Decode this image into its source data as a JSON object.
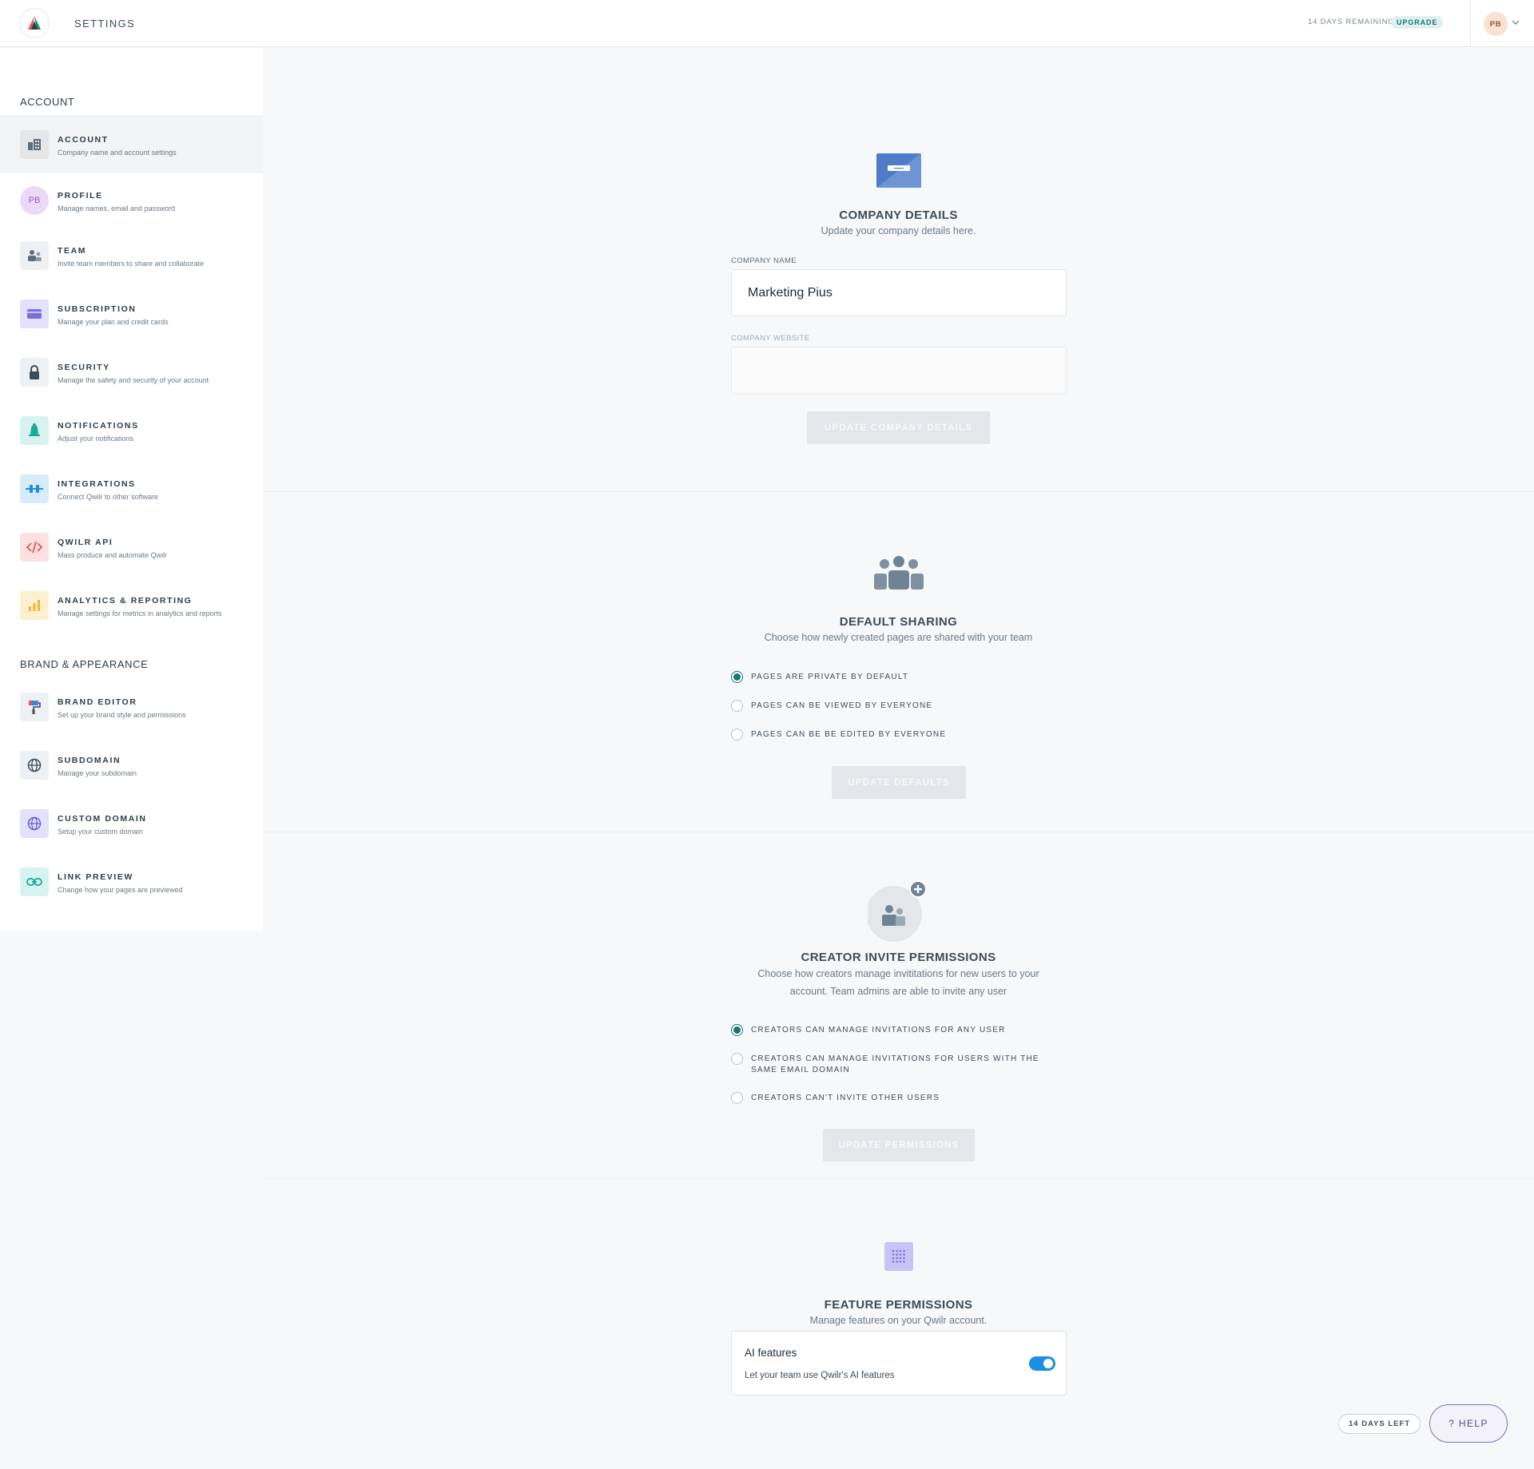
{
  "header": {
    "title": "SETTINGS",
    "trial_text": "14 DAYS REMAINING",
    "upgrade_label": "UPGRADE",
    "avatar_initials": "PB"
  },
  "sidebar": {
    "sections": [
      {
        "title": "ACCOUNT",
        "items": [
          {
            "label": "ACCOUNT",
            "desc": "Company name and account settings",
            "icon": "building-icon",
            "active": true
          },
          {
            "label": "PROFILE",
            "desc": "Manage names, email and password",
            "icon": "profile-avatar-icon",
            "avatar_initials": "PB"
          },
          {
            "label": "TEAM",
            "desc": "Invite team members to share and collaborate",
            "icon": "team-icon"
          },
          {
            "label": "SUBSCRIPTION",
            "desc": "Manage your plan and credit cards",
            "icon": "credit-card-icon"
          },
          {
            "label": "SECURITY",
            "desc": "Manage the safety and security of your account",
            "icon": "lock-icon"
          },
          {
            "label": "NOTIFICATIONS",
            "desc": "Adjust your notifications",
            "icon": "bell-icon"
          },
          {
            "label": "INTEGRATIONS",
            "desc": "Connect Qwilr to other software",
            "icon": "plug-icon"
          },
          {
            "label": "QWILR API",
            "desc": "Mass produce and automate Qwilr",
            "icon": "code-icon"
          },
          {
            "label": "ANALYTICS & REPORTING",
            "desc": "Manage settings for metrics in analytics and reports",
            "icon": "bar-chart-icon"
          }
        ]
      },
      {
        "title": "BRAND & APPEARANCE",
        "items": [
          {
            "label": "BRAND EDITOR",
            "desc": "Set up your brand style and permissions",
            "icon": "paint-roller-icon"
          },
          {
            "label": "SUBDOMAIN",
            "desc": "Manage your subdomain",
            "icon": "globe-icon"
          },
          {
            "label": "CUSTOM DOMAIN",
            "desc": "Setup your custom domain",
            "icon": "globe-purple-icon"
          },
          {
            "label": "LINK PREVIEW",
            "desc": "Change how your pages are previewed",
            "icon": "link-icon"
          }
        ]
      }
    ]
  },
  "company": {
    "title": "COMPANY DETAILS",
    "subtitle": "Update your company details here.",
    "name_label": "COMPANY NAME",
    "name_value": "Marketing Pius",
    "website_label": "COMPANY WEBSITE",
    "website_value": "",
    "button": "UPDATE COMPANY DETAILS"
  },
  "sharing": {
    "title": "DEFAULT SHARING",
    "subtitle": "Choose how newly created pages are shared with your team",
    "options": [
      {
        "label": "PAGES ARE PRIVATE BY DEFAULT",
        "selected": true
      },
      {
        "label": "PAGES CAN BE VIEWED BY EVERYONE",
        "selected": false
      },
      {
        "label": "PAGES CAN BE BE EDITED BY EVERYONE",
        "selected": false
      }
    ],
    "button": "UPDATE DEFAULTS"
  },
  "invite": {
    "title": "CREATOR INVITE PERMISSIONS",
    "subtitle_line1": "Choose how creators manage invititations for new users to your",
    "subtitle_line2": "account. Team admins are able to invite any user",
    "options": [
      {
        "label": "CREATORS CAN MANAGE INVITATIONS FOR ANY USER",
        "selected": true
      },
      {
        "label": "CREATORS CAN MANAGE INVITATIONS FOR USERS WITH THE SAME EMAIL DOMAIN",
        "selected": false
      },
      {
        "label": "CREATORS CAN'T INVITE OTHER USERS",
        "selected": false
      }
    ],
    "button": "UPDATE PERMISSIONS"
  },
  "features": {
    "title": "FEATURE PERMISSIONS",
    "subtitle": "Manage features on your Qwilr account.",
    "card_title": "AI features",
    "card_desc": "Let your team use Qwilr's AI features",
    "enabled": true
  },
  "footer": {
    "days_left": "14 DAYS LEFT",
    "help": "? HELP"
  },
  "colors": {
    "accent_teal": "#16796f",
    "toggle_blue": "#1c8fe0",
    "company_icon_blue": "#4f7cc9",
    "help_border": "#7b6fc4"
  }
}
